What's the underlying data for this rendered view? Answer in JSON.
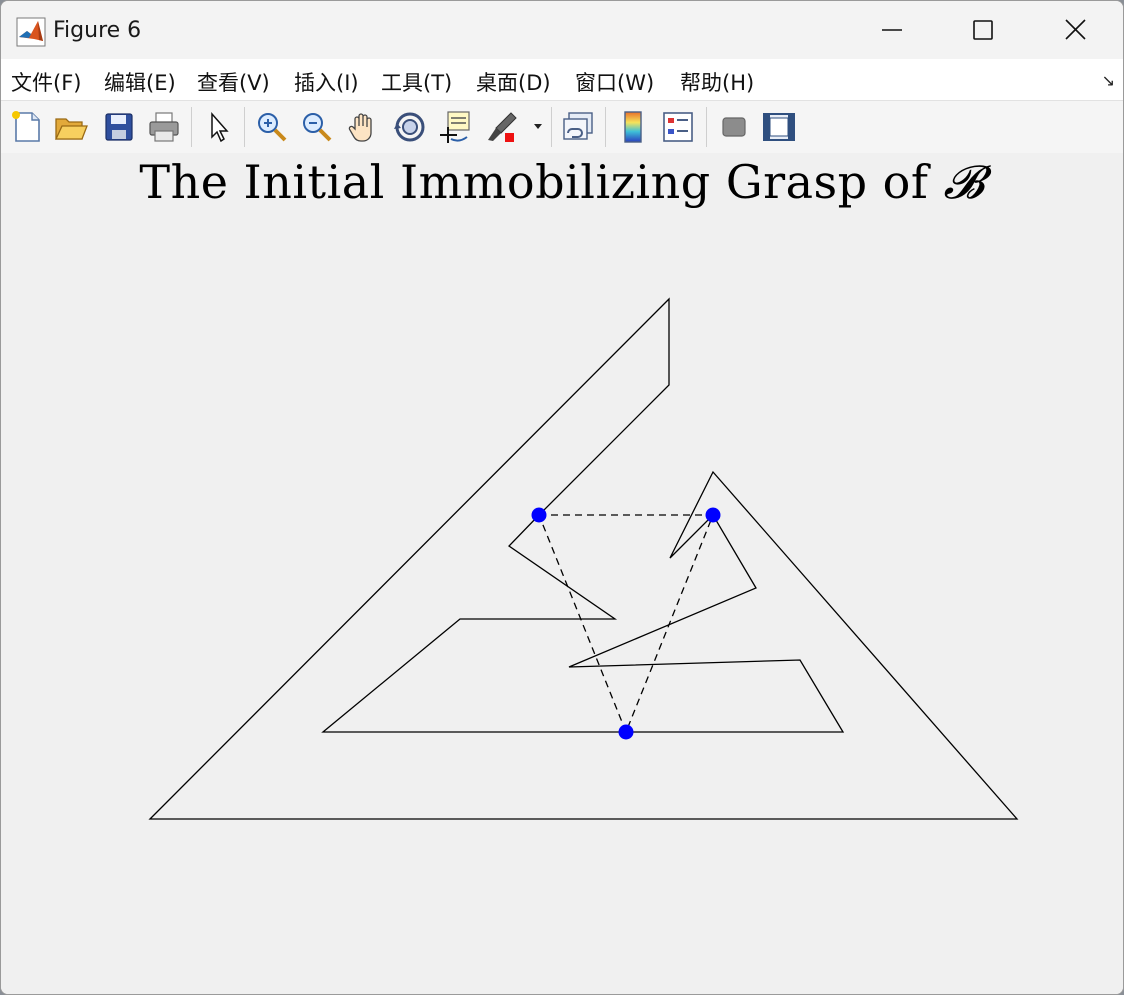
{
  "window": {
    "title": "Figure 6"
  },
  "menubar": {
    "items": [
      {
        "label": "文件(F)"
      },
      {
        "label": "编辑(E)"
      },
      {
        "label": "查看(V)"
      },
      {
        "label": "插入(I)"
      },
      {
        "label": "工具(T)"
      },
      {
        "label": "桌面(D)"
      },
      {
        "label": "窗口(W)"
      },
      {
        "label": "帮助(H)"
      }
    ],
    "dock_glyph": "↘"
  },
  "toolbar": {
    "icons": [
      "new-figure-icon",
      "open-file-icon",
      "save-icon",
      "print-icon",
      "edit-plot-arrow-icon",
      "zoom-in-icon",
      "zoom-out-icon",
      "pan-hand-icon",
      "rotate-3d-icon",
      "data-cursor-icon",
      "brush-icon",
      "link-plot-icon",
      "colorbar-icon",
      "legend-icon",
      "hide-plot-tools-icon",
      "show-plot-tools-icon"
    ]
  },
  "figure": {
    "title_text": "The Initial Immobilizing Grasp of ",
    "title_symbol": "𝓑"
  },
  "chart_data": {
    "type": "line",
    "title": "The Initial Immobilizing Grasp of 𝓑",
    "axes_visible": false,
    "series": [
      {
        "kind": "polygon-outline",
        "color": "#000000",
        "points": [
          [
            149,
            818
          ],
          [
            668,
            298
          ],
          [
            668,
            384
          ],
          [
            538,
            514
          ],
          [
            508,
            545
          ],
          [
            614,
            618
          ],
          [
            459,
            618
          ],
          [
            322,
            731
          ],
          [
            842,
            731
          ],
          [
            799,
            659
          ],
          [
            568,
            666
          ],
          [
            755,
            587
          ],
          [
            712,
            514
          ],
          [
            669,
            557
          ],
          [
            712,
            471
          ],
          [
            1016,
            818
          ]
        ]
      },
      {
        "kind": "grasp-triangle",
        "color": "#000000",
        "dashed": true,
        "points": [
          [
            538,
            514
          ],
          [
            712,
            514
          ],
          [
            625,
            731
          ]
        ]
      }
    ],
    "contact_points": {
      "color": "#0000ff",
      "points": [
        [
          538,
          514
        ],
        [
          712,
          514
        ],
        [
          625,
          731
        ]
      ]
    }
  }
}
